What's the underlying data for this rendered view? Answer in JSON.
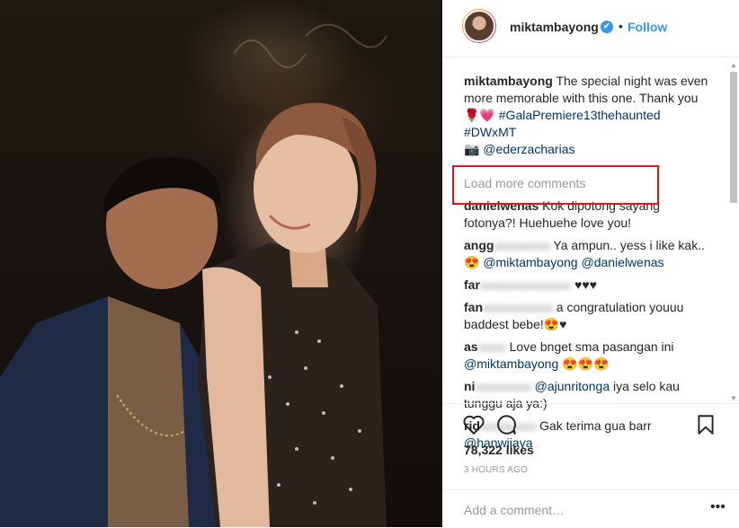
{
  "post": {
    "username": "miktambayong",
    "follow_label": "Follow",
    "separator": "•",
    "verified_glyph": "✔"
  },
  "caption": {
    "username": "miktambayong",
    "text": "The special night was even more memorable with this one. Thank you",
    "emoji": "🌹💗",
    "hashtag1": "#GalaPremiere13thehaunted",
    "hashtag2": "#DWxMT",
    "camera_glyph": "📷",
    "mention": "@ederzacharias"
  },
  "load_more": "Load more comments",
  "comments": [
    {
      "username": "danielwenas",
      "text": "Kok dipotong sayang fotonya?! Huehuehe love you!"
    },
    {
      "username": "angg",
      "text": "Ya ampun.. yess i like kak..",
      "line2_emoji": "😍",
      "mention1": "@miktambayong",
      "mention2": "@danielwenas"
    },
    {
      "username": "far",
      "text": "♥♥♥"
    },
    {
      "username": "fan",
      "text": "a congratulation youuu baddest bebe!😍♥"
    },
    {
      "username": "as",
      "text": "Love bnget sma pasangan ini",
      "mention": "@miktambayong",
      "emoji": "😍😍😍"
    },
    {
      "username": "ni",
      "mention": "@ajunritonga",
      "text": "iya selo kau tunggu aja ya:)"
    },
    {
      "username": "rid",
      "text": "Gak terima gua barr",
      "mention": "@hanwijaya"
    }
  ],
  "icons": {
    "heart": "heart-icon",
    "comment": "comment-bubble-icon",
    "bookmark": "bookmark-icon",
    "more": "more-options-icon"
  },
  "likes": "78,322 likes",
  "time": "3 HOURS AGO",
  "add_comment_placeholder": "Add a comment…",
  "more_options_glyph": "•••",
  "colors": {
    "accent": "#3897f0",
    "highlight_border": "#e0141e",
    "muted": "#999999"
  }
}
